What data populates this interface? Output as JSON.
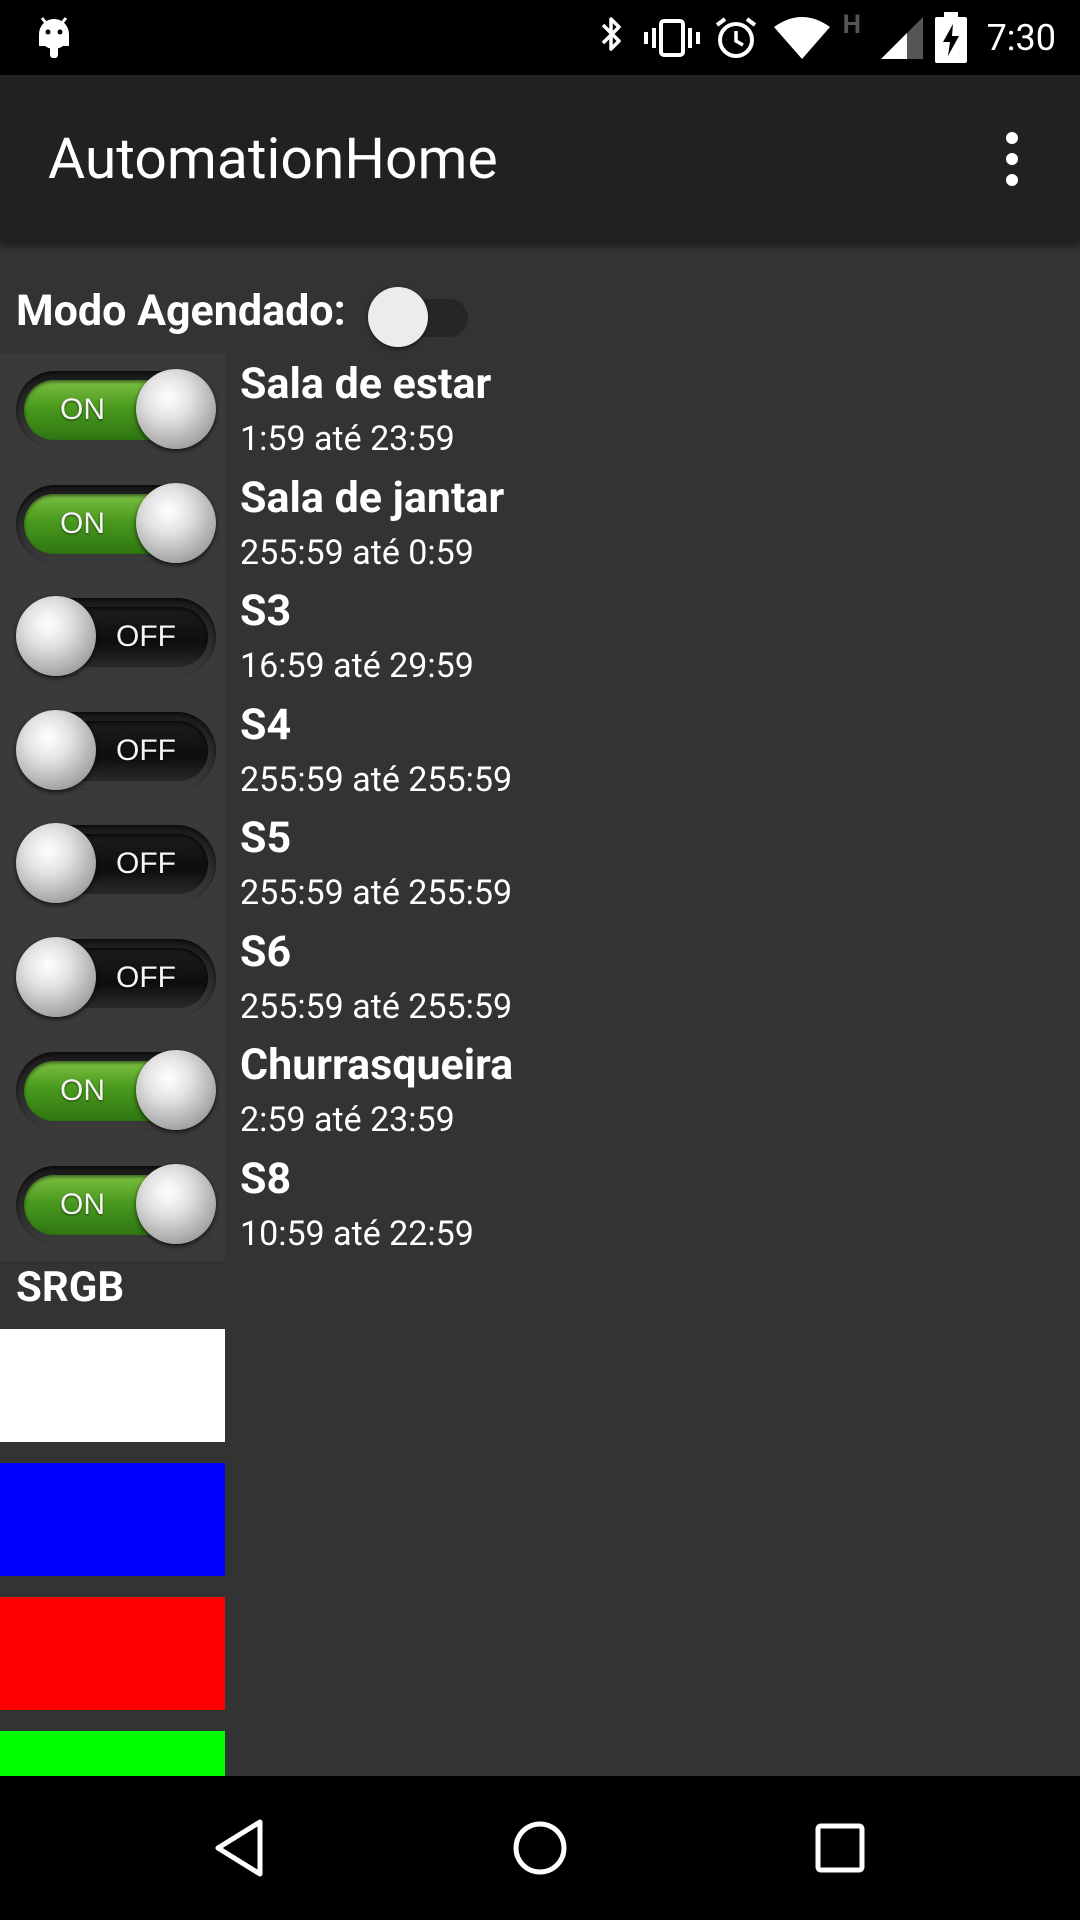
{
  "status_bar": {
    "time": "7:30",
    "network_type": "H",
    "icons": [
      "android-debug-icon",
      "bluetooth-icon",
      "vibrate-icon",
      "alarm-icon",
      "wifi-icon",
      "signal-icon",
      "battery-charging-icon"
    ]
  },
  "app_bar": {
    "title": "AutomationHome",
    "menu_icon": "overflow-menu-icon"
  },
  "schedule_mode": {
    "label": "Modo Agendado:",
    "enabled": false
  },
  "devices": [
    {
      "name": "Sala de estar",
      "time": "1:59 até 23:59",
      "state": "ON"
    },
    {
      "name": "Sala de jantar",
      "time": "255:59 até 0:59",
      "state": "ON"
    },
    {
      "name": "S3",
      "time": "16:59 até 29:59",
      "state": "OFF"
    },
    {
      "name": "S4",
      "time": "255:59 até 255:59",
      "state": "OFF"
    },
    {
      "name": "S5",
      "time": "255:59 até 255:59",
      "state": "OFF"
    },
    {
      "name": "S6",
      "time": "255:59 até 255:59",
      "state": "OFF"
    },
    {
      "name": "Churrasqueira",
      "time": "2:59 até 23:59",
      "state": "ON"
    },
    {
      "name": "S8",
      "time": "10:59 até 22:59",
      "state": "ON"
    }
  ],
  "srgb": {
    "label": "SRGB",
    "swatches": [
      "#ffffff",
      "#0000ff",
      "#ff0000",
      "#00ff00"
    ]
  },
  "nav_bar": {
    "icons": [
      "back-icon",
      "home-icon",
      "recents-icon"
    ]
  }
}
